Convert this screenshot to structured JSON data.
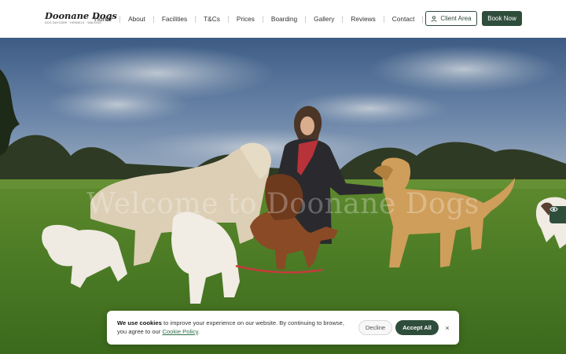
{
  "header": {
    "logo_name": "Doonane Dogs",
    "logo_tagline": "DOG DAYCARE · KENNELS · WALKING",
    "nav": [
      "Home",
      "About",
      "Facilities",
      "T&Cs",
      "Prices",
      "Boarding",
      "Gallery",
      "Reviews",
      "Contact"
    ],
    "client_area_label": "Client Area",
    "book_now_label": "Book Now"
  },
  "hero": {
    "title": "Welcome to Doonane Dogs"
  },
  "cookie_banner": {
    "bold_text": "We use cookies",
    "text": " to improve your experience on our website. By continuing to browse, you agree to our ",
    "link_text": "Cookie Policy",
    "end_text": ".",
    "decline_label": "Decline",
    "accept_label": "Accept All",
    "close_glyph": "×"
  },
  "colors": {
    "brand_green": "#2f4d3b",
    "nav_text": "#333333"
  },
  "icons": {
    "client": "user-icon",
    "accessibility": "eye-icon",
    "close": "close-icon"
  }
}
